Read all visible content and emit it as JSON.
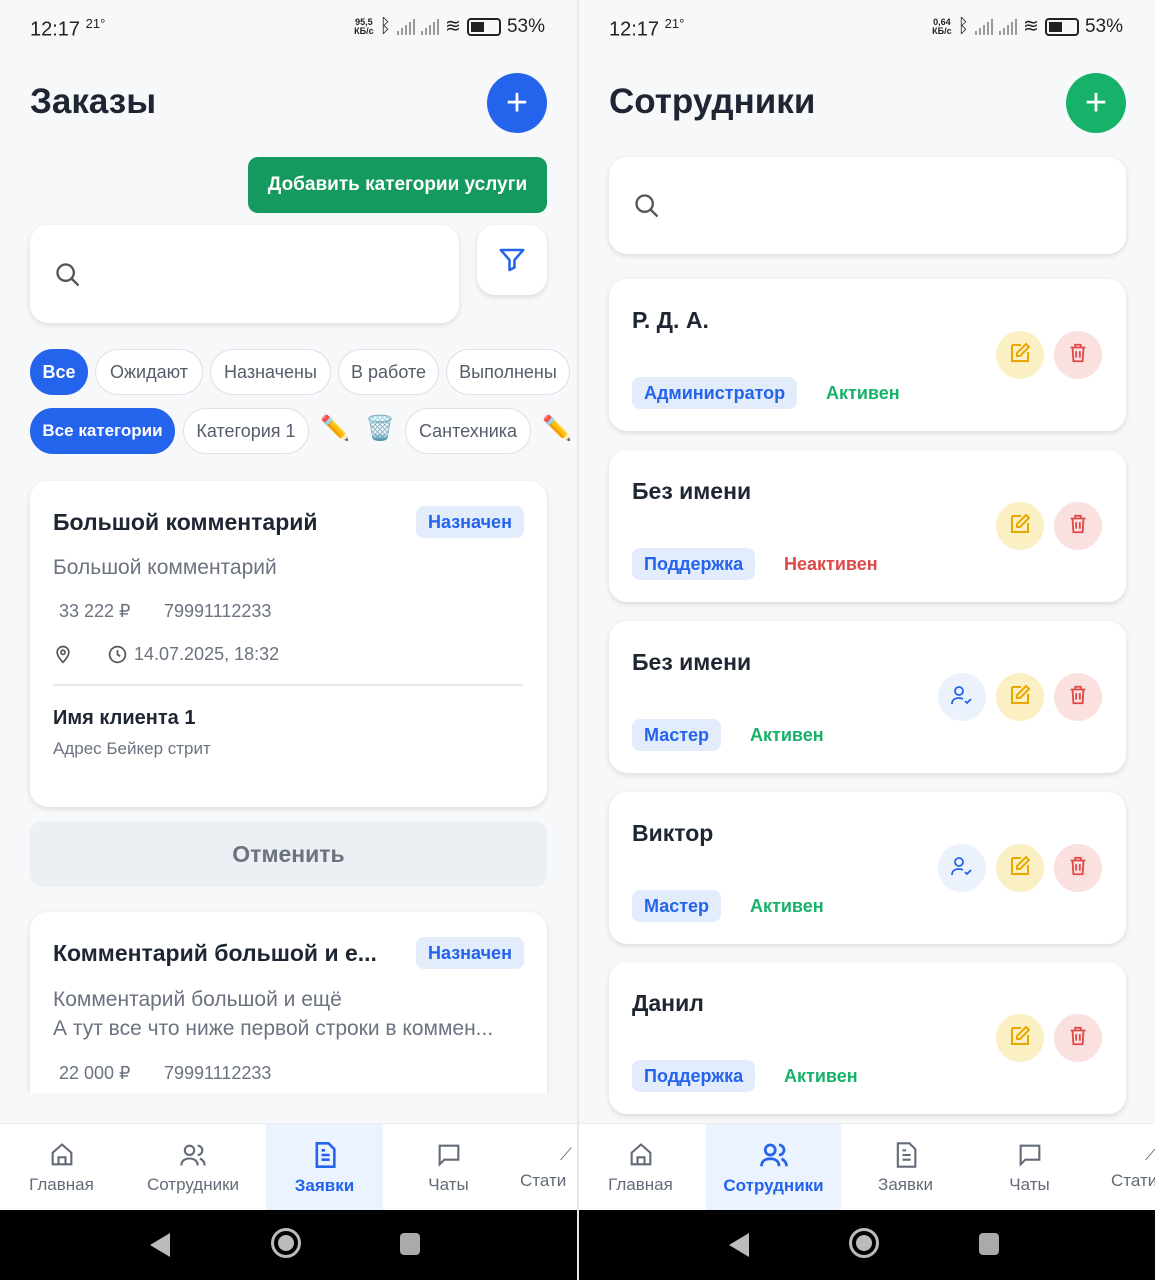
{
  "colors": {
    "primary": "#2463eb",
    "success": "#17b26a",
    "danger": "#e04848",
    "warning": "#f5c542"
  },
  "left": {
    "status_bar": {
      "time": "12:17",
      "temp": "21°",
      "speed_top": "95,5",
      "speed_unit": "КБ/с",
      "battery": "53%"
    },
    "title": "Заказы",
    "add_icon": "plus-icon",
    "add_category_label": "Добавить категории услуги",
    "search": {
      "placeholder": ""
    },
    "status_chips": [
      "Все",
      "Ожидают",
      "Назначены",
      "В работе",
      "Выполнены"
    ],
    "category_chips": [
      "Все категории",
      "Категория 1",
      "Сантехника"
    ],
    "orders": [
      {
        "title": "Большой комментарий",
        "badge": "Назначен",
        "comment": "Большой комментарий",
        "price": "33 222 ₽",
        "phone": "79991112233",
        "datetime": "14.07.2025, 18:32",
        "client": "Имя клиента 1",
        "address": "Адрес Бейкер стрит",
        "cancel": "Отменить"
      },
      {
        "title": "Комментарий большой и е...",
        "badge": "Назначен",
        "comment_line1": "Комментарий большой и ещё",
        "comment_line2": "А тут все что ниже первой строки в коммен...",
        "price": "22 000 ₽",
        "phone": "79991112233"
      }
    ],
    "nav": [
      "Главная",
      "Сотрудники",
      "Заявки",
      "Чаты",
      "Стати"
    ],
    "nav_active": "Заявки"
  },
  "right": {
    "status_bar": {
      "time": "12:17",
      "temp": "21°",
      "speed_top": "0,64",
      "speed_unit": "КБ/с",
      "battery": "53%"
    },
    "title": "Сотрудники",
    "search": {
      "placeholder": ""
    },
    "employees": [
      {
        "name": "Р. Д. А.",
        "role": "Администратор",
        "status": "Активен",
        "active": true,
        "assign": false
      },
      {
        "name": "Без имени",
        "role": "Поддержка",
        "status": "Неактивен",
        "active": false,
        "assign": false
      },
      {
        "name": "Без имени",
        "role": "Мастер",
        "status": "Активен",
        "active": true,
        "assign": true
      },
      {
        "name": "Виктор",
        "role": "Мастер",
        "status": "Активен",
        "active": true,
        "assign": true
      },
      {
        "name": "Данил",
        "role": "Поддержка",
        "status": "Активен",
        "active": true,
        "assign": false
      }
    ],
    "nav": [
      "Главная",
      "Сотрудники",
      "Заявки",
      "Чаты",
      "Стати"
    ],
    "nav_active": "Сотрудники"
  }
}
